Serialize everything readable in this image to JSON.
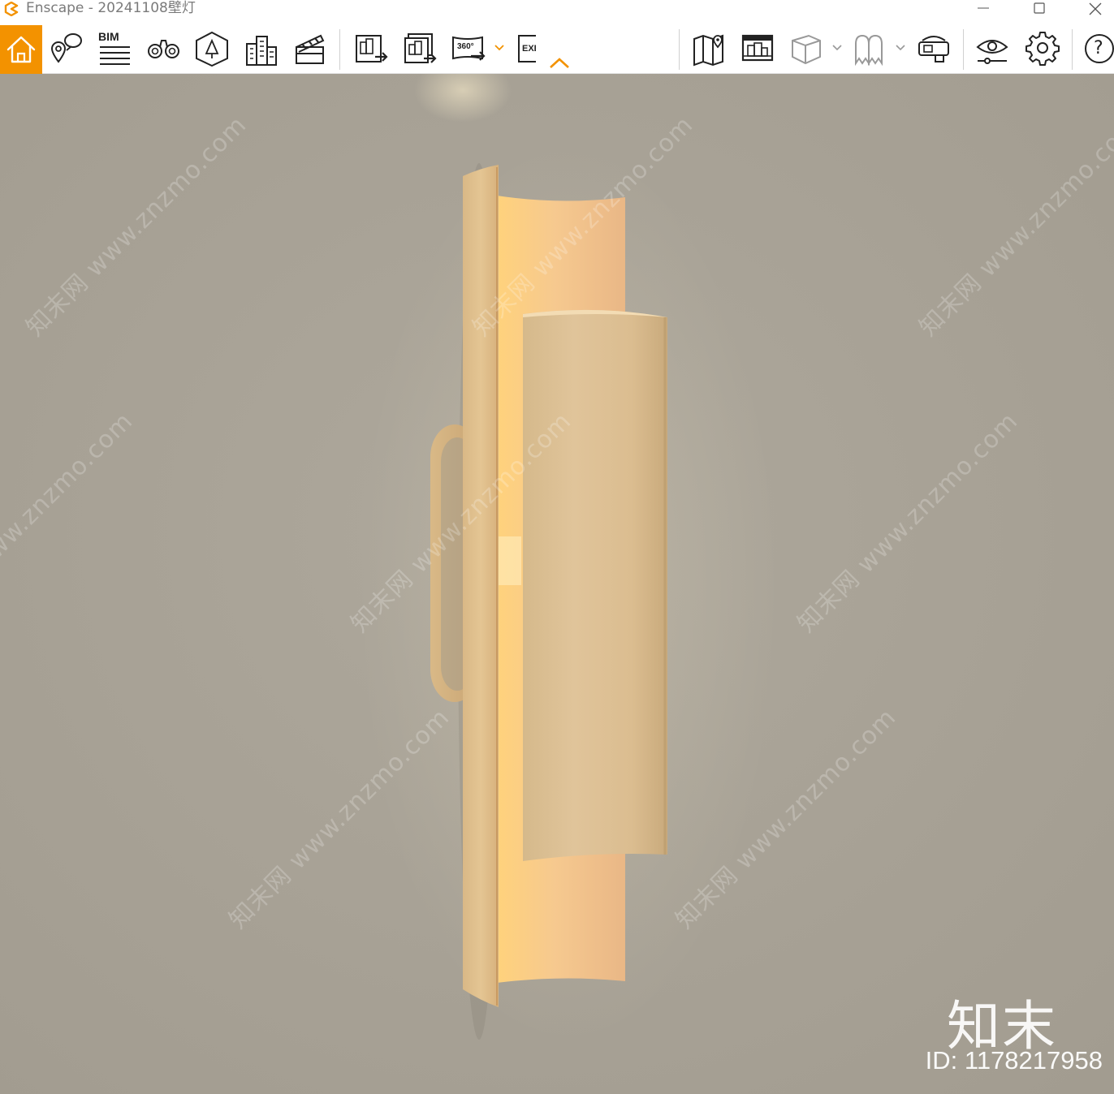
{
  "window": {
    "app_name": "Enscape",
    "title": "Enscape - 20241108壁灯",
    "controls": [
      "minimize",
      "maximize",
      "close"
    ]
  },
  "toolbar": {
    "accent_color": "#f39200",
    "home": {
      "icon": "home-icon",
      "active": true
    },
    "groups": [
      {
        "name": "navigation",
        "items": [
          {
            "id": "views",
            "icon": "location-pin-icon"
          },
          {
            "id": "bim",
            "icon": "bim-icon",
            "label": "BIM"
          },
          {
            "id": "binoculars",
            "icon": "binoculars-icon"
          },
          {
            "id": "asset-library",
            "icon": "asset-library-icon"
          },
          {
            "id": "buildings",
            "icon": "buildings-icon"
          },
          {
            "id": "video-editor",
            "icon": "clapperboard-icon"
          }
        ]
      },
      {
        "name": "export",
        "items": [
          {
            "id": "render-image",
            "icon": "render-image-icon"
          },
          {
            "id": "batch-render",
            "icon": "batch-render-icon"
          },
          {
            "id": "panorama",
            "icon": "panorama-icon",
            "label": "360°",
            "dropdown": true
          },
          {
            "id": "exe",
            "icon": "export-exe-icon",
            "label": "EXE"
          }
        ]
      },
      {
        "name": "scene",
        "items": [
          {
            "id": "map",
            "icon": "map-icon"
          },
          {
            "id": "material-editor",
            "icon": "window-icon"
          },
          {
            "id": "cube",
            "icon": "cube-icon",
            "dropdown": true
          },
          {
            "id": "ghost",
            "icon": "ghost-icon",
            "dropdown": true
          },
          {
            "id": "vr",
            "icon": "vr-headset-icon"
          }
        ]
      },
      {
        "name": "settings",
        "items": [
          {
            "id": "visual-settings",
            "icon": "eye-settings-icon"
          },
          {
            "id": "general-settings",
            "icon": "gear-icon"
          }
        ]
      },
      {
        "name": "help",
        "items": [
          {
            "id": "help",
            "icon": "help-icon",
            "label": "?"
          }
        ]
      }
    ],
    "collapse_icon": "chevron-up-icon"
  },
  "viewport": {
    "wall_color": "#a9a397",
    "lamp_wood_color": "#e2c293",
    "glow_color": "#ffd89a",
    "watermark_text": "知末网 www.znzmo.com",
    "brand_logo": "知末",
    "brand_id": "ID: 1178217958"
  }
}
